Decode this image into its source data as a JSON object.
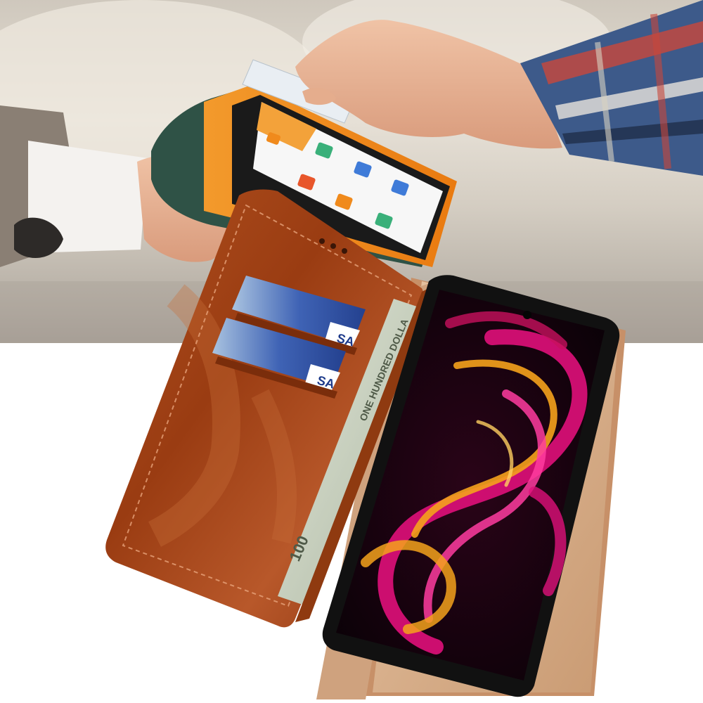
{
  "scene": {
    "description_kind": "product-photo",
    "card_brand_text": "SA",
    "banknote_text": "ONE HUNDRED DOLLA",
    "banknote_denomination": "100",
    "colors": {
      "leather": "#9c3f15",
      "leather_light": "#c4622a",
      "inner_lining": "#d9b08e",
      "phone_frame": "#111111",
      "pos_terminal": "#f08a1c",
      "card_blue": "#2b4fa8",
      "banknote": "#c9d2bf",
      "screen_pink": "#e0107a",
      "screen_orange": "#f5a21c",
      "background_blur": "#d8d2c8",
      "white": "#ffffff"
    }
  }
}
